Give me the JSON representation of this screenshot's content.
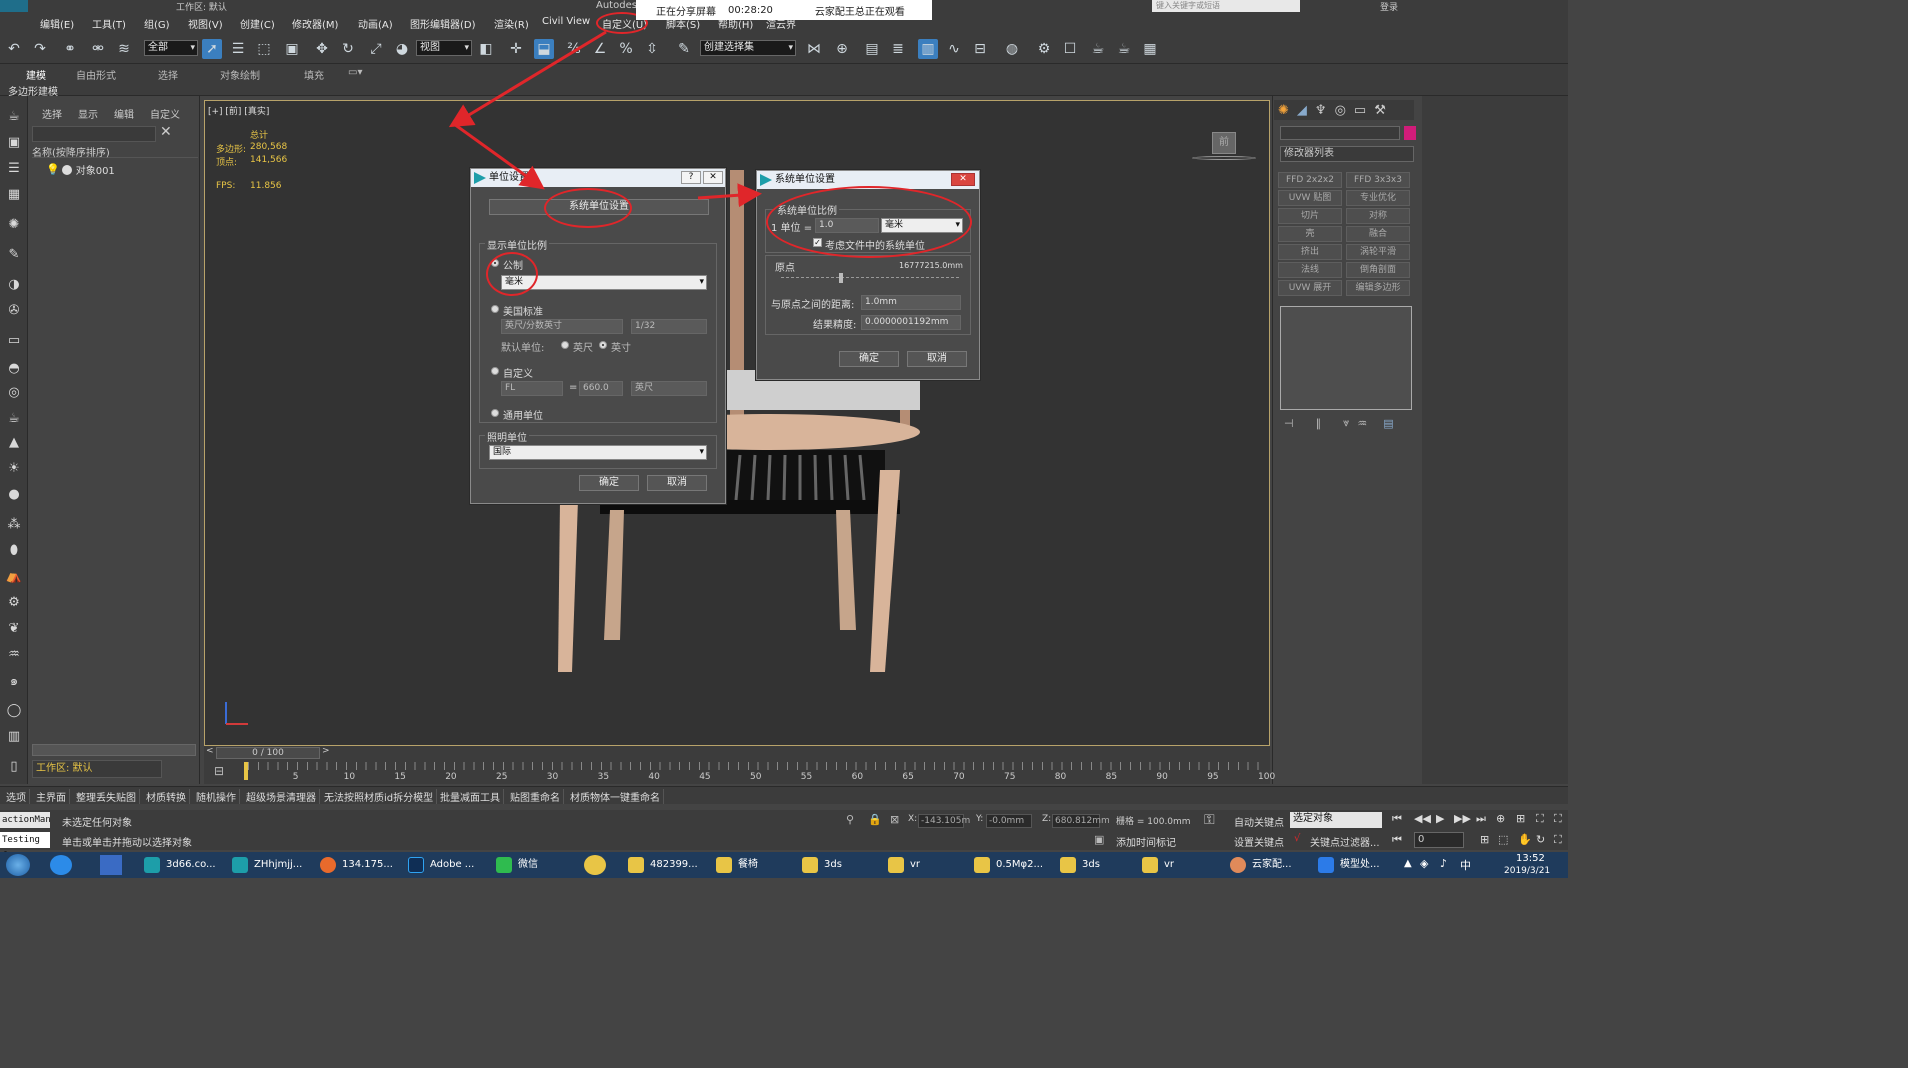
{
  "app": {
    "title_partial": "Autodes",
    "workspace_label": "工作区: 默认",
    "logo": "MAX",
    "search_placeholder": "键入关键字或短语",
    "login": "登录"
  },
  "share_banner": {
    "status": "正在分享屏幕",
    "time": "00:28:20",
    "viewer": "云家配王总正在观看"
  },
  "menu": [
    "编辑(E)",
    "工具(T)",
    "组(G)",
    "视图(V)",
    "创建(C)",
    "修改器(M)",
    "动画(A)",
    "图形编辑器(D)",
    "渲染(R)",
    "Civil View",
    "自定义(U)",
    "脚本(S)",
    "帮助(H)",
    "渲云界"
  ],
  "toolbar": {
    "filter_dropdown": "全部",
    "view_dropdown": "视图",
    "selection_set": "创建选择集",
    "icons": [
      "undo-icon",
      "redo-icon",
      "link-icon",
      "unlink-icon",
      "bind-space-warp-icon",
      "select-icon",
      "select-by-name-icon",
      "rect-select-icon",
      "window-crossing-icon",
      "move-icon",
      "rotate-icon",
      "scale-icon",
      "place-icon",
      "mirror-icon",
      "align-icon",
      "layer-icon",
      "curve-editor-icon",
      "schematic-icon",
      "material-editor-icon",
      "render-setup-icon",
      "render-frame-icon",
      "render-icon"
    ]
  },
  "ribbon": {
    "tabs": [
      "建模",
      "自由形式",
      "选择",
      "对象绘制",
      "填充"
    ],
    "sub": "多边形建模"
  },
  "scene_explorer": {
    "tabs": [
      "选择",
      "显示",
      "编辑",
      "自定义"
    ],
    "column": "名称(按降序排序)",
    "items": [
      "对象001"
    ],
    "workspace": "工作区: 默认"
  },
  "viewport": {
    "label": "[+] [前] [真实]",
    "stats": {
      "total_label": "总计",
      "polys_label": "多边形:",
      "polys": "280,568",
      "verts_label": "顶点:",
      "verts": "141,566",
      "fps_label": "FPS:",
      "fps": "11.856"
    },
    "cube_label": "前"
  },
  "units_dialog": {
    "title": "单位设置",
    "system_button": "系统单位设置",
    "display_group": "显示单位比例",
    "metric_label": "公制",
    "metric_value": "毫米",
    "us_label": "美国标准",
    "us_value": "英尺/分数英寸",
    "us_fraction": "1/32",
    "default_unit_label": "默认单位:",
    "feet_label": "英尺",
    "inch_label": "英寸",
    "custom_label": "自定义",
    "custom_name": "FL",
    "custom_value": "660.0",
    "custom_unit": "英尺",
    "generic_label": "通用单位",
    "lighting_group": "照明单位",
    "lighting_value": "国际",
    "ok": "确定",
    "cancel": "取消"
  },
  "system_dialog": {
    "title": "系统单位设置",
    "scale_group": "系统单位比例",
    "unit_prefix": "1 单位 =",
    "unit_value": "1.0",
    "unit_type": "毫米",
    "respect_label": "考虑文件中的系统单位",
    "origin_label": "原点",
    "origin_value": "16777215.0mm",
    "distance_label": "与原点之间的距离:",
    "distance_value": "1.0mm",
    "precision_label": "结果精度:",
    "precision_value": "0.0000001192mm",
    "ok": "确定",
    "cancel": "取消"
  },
  "command_panel": {
    "modifier_list": "修改器列表",
    "modifiers": [
      "FFD 2x2x2",
      "FFD 3x3x3",
      "UVW 贴图",
      "专业优化",
      "切片",
      "对称",
      "壳",
      "融合",
      "挤出",
      "涡轮平滑",
      "法线",
      "倒角剖面",
      "UVW 展开",
      "编辑多边形"
    ]
  },
  "timeline": {
    "frame": "0 / 100",
    "ticks": [
      "5",
      "10",
      "15",
      "20",
      "25",
      "30",
      "35",
      "40",
      "45",
      "50",
      "55",
      "60",
      "65",
      "70",
      "75",
      "80",
      "85",
      "90",
      "95",
      "100"
    ]
  },
  "plugin_bar": [
    "选项",
    "主界面",
    "整理丢失贴图",
    "材质转换",
    "随机操作",
    "超级场景清理器",
    "无法按照材质id拆分模型",
    "批量减面工具",
    "贴图重命名",
    "材质物体一键重命名"
  ],
  "status": {
    "maxscript_1": "actionMan",
    "maxscript_2": "Testing f",
    "message_1": "未选定任何对象",
    "message_2": "单击或单击并拖动以选择对象",
    "x_label": "X:",
    "x": "-143.105m",
    "y_label": "Y:",
    "y": "-0.0mm",
    "z_label": "Z:",
    "z": "680.812mm",
    "grid": "栅格 = 100.0mm",
    "add_time_tag": "添加时间标记",
    "auto_key": "自动关键点",
    "set_key": "设置关键点",
    "selected_object": "选定对象",
    "key_filters": "关键点过滤器...",
    "frame_field": "0"
  },
  "taskbar": {
    "tasks": [
      "3d66.co...",
      "ZHhjmjj...",
      "134.175...",
      "Adobe ...",
      "微信",
      "482399...",
      "餐椅",
      "3ds",
      "vr",
      "0.5Mφ2...",
      "3ds",
      "vr",
      "云家配...",
      "模型处..."
    ],
    "time": "13:52",
    "date": "2019/3/21"
  },
  "colors": {
    "accent_red": "#e0262a",
    "viewport_border": "#b8a36a",
    "stat_yellow": "#e8c546",
    "taskbar": "#1f3b5c"
  }
}
